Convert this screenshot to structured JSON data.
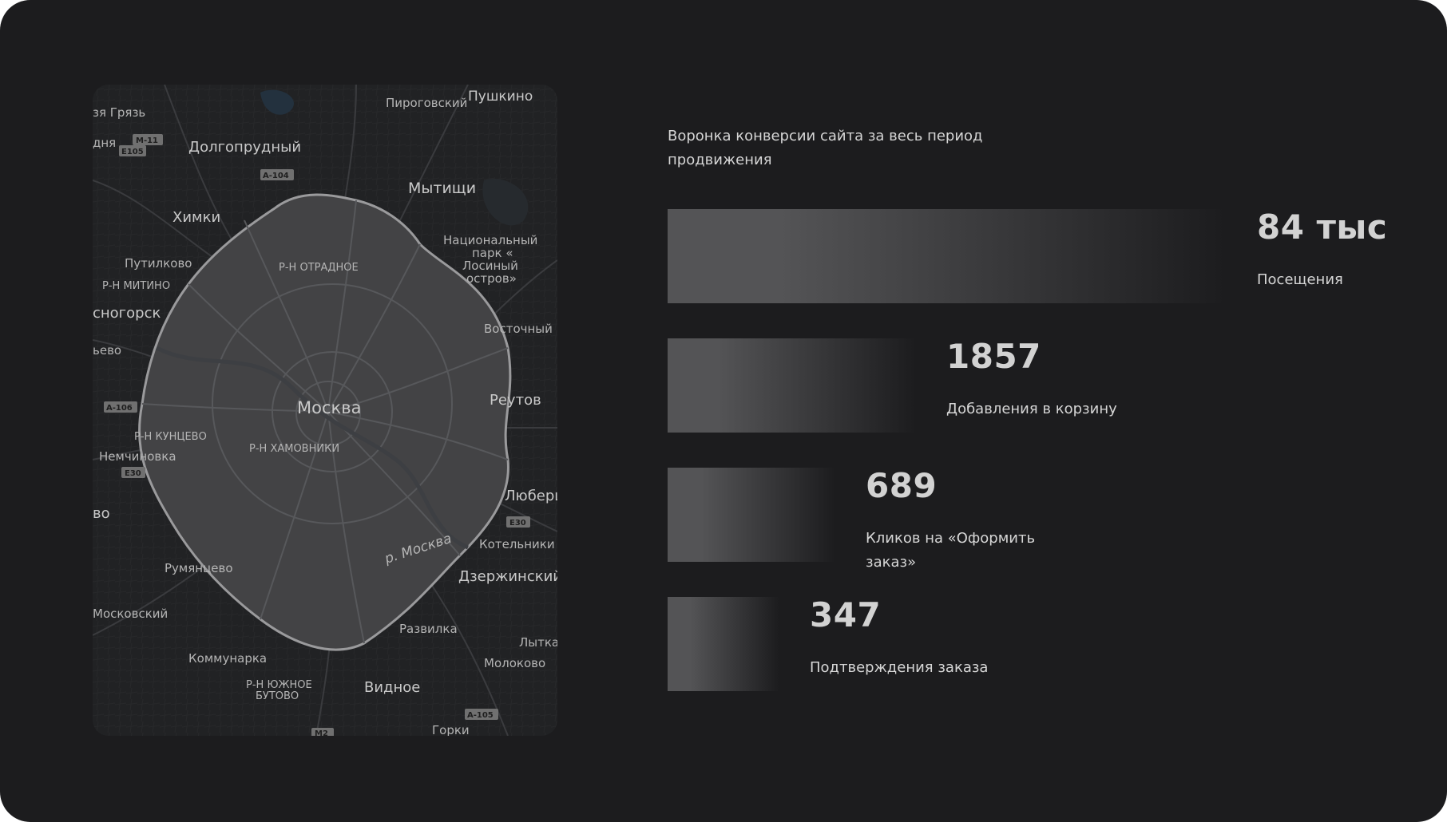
{
  "colors": {
    "background": "#1c1c1e",
    "bar_light": "#545456",
    "bar_dark": "#1c1c1e",
    "text": "#d6d6d6"
  },
  "map": {
    "center_label": "Москва",
    "river_label": "р. Москва",
    "places": [
      "Пироговский",
      "Пушкино",
      "зя Грязь",
      "дня",
      "Долгопрудный",
      "Мытищи",
      "Химки",
      "Национальный",
      "парк «",
      "Лосиный",
      "остров»",
      "Путилково",
      "Р-Н ОТРАДНОЕ",
      "Р-Н МИТИНО",
      "сногорск",
      "Восточный",
      "ьево",
      "Реутов",
      "Р-Н КУНЦЕВО",
      "Р-Н ХАМОВНИКИ",
      "Немчиновка",
      "Люберц",
      "во",
      "Котельники",
      "Румянцево",
      "Дзержинский",
      "Московский",
      "Развилка",
      "Лытка",
      "Коммунарка",
      "Молоково",
      "Р-Н ЮЖНОЕ",
      "БУТОВО",
      "Видное",
      "Горки"
    ],
    "road_shields": [
      "M-11",
      "E105",
      "A-104",
      "A-106",
      "E30",
      "E30",
      "A-105",
      "M2"
    ]
  },
  "chart_data": {
    "type": "bar",
    "title": "Воронка конверсии сайта за весь период продвижения",
    "categories": [
      "Посещения",
      "Добавления в корзину",
      "Кликов на «Оформить заказ»",
      "Подтверждения заказа"
    ],
    "values": [
      84000,
      1857,
      689,
      347
    ],
    "value_labels": [
      "84 тыс",
      "1857",
      "689",
      "347"
    ],
    "orientation": "horizontal",
    "grid": false,
    "legend": "none"
  }
}
